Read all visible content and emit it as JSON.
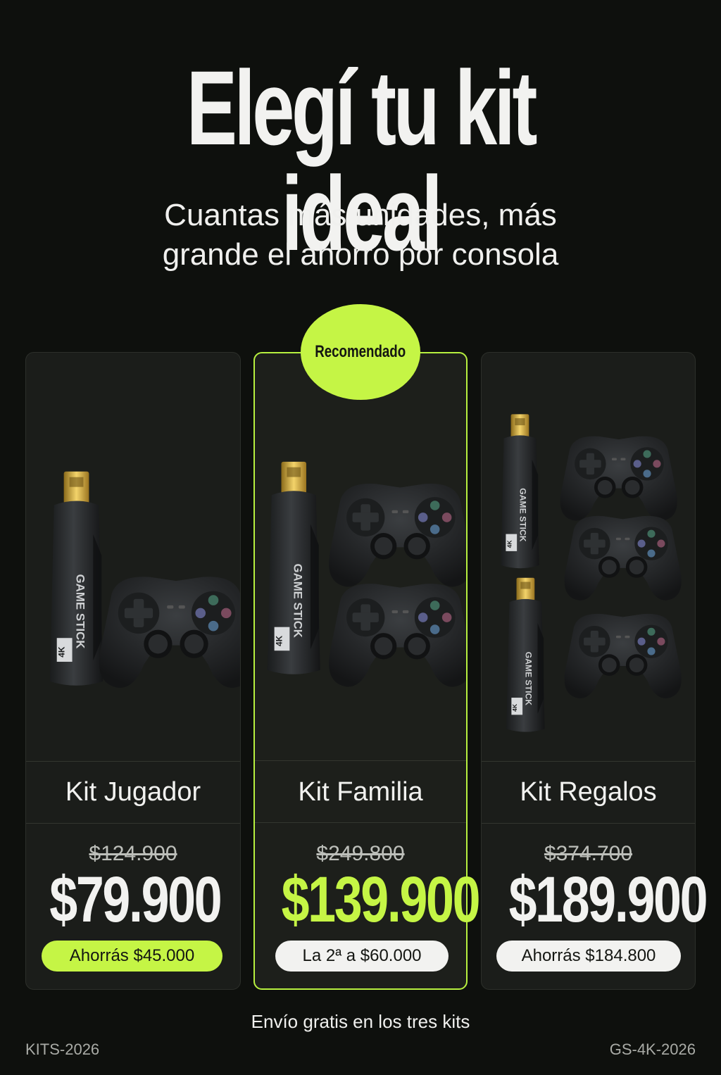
{
  "headline": "Elegí tu kit ideal",
  "subhead": {
    "line1": "Cuantas más unidades, más",
    "line2": "grande el ahorro por consola"
  },
  "badge": "Recomendado",
  "kits": [
    {
      "name": "Kit Jugador",
      "old_price": "$124.900",
      "price": "$79.900",
      "pill": "Ahorrás $45.000"
    },
    {
      "name": "Kit Familia",
      "old_price": "$249.800",
      "price": "$139.900",
      "pill": "La 2ª a $60.000"
    },
    {
      "name": "Kit Regalos",
      "old_price": "$374.700",
      "price": "$189.900",
      "pill": "Ahorrás $184.800"
    }
  ],
  "product_label": "GAME STICK",
  "product_badge": "4K",
  "footer_note": "Envío gratis en los tres kits",
  "code_left": "KITS-2026",
  "code_right": "GS-4K-2026",
  "colors": {
    "accent": "#c5f545",
    "background": "#0e100d",
    "card": "#1b1d1a"
  }
}
